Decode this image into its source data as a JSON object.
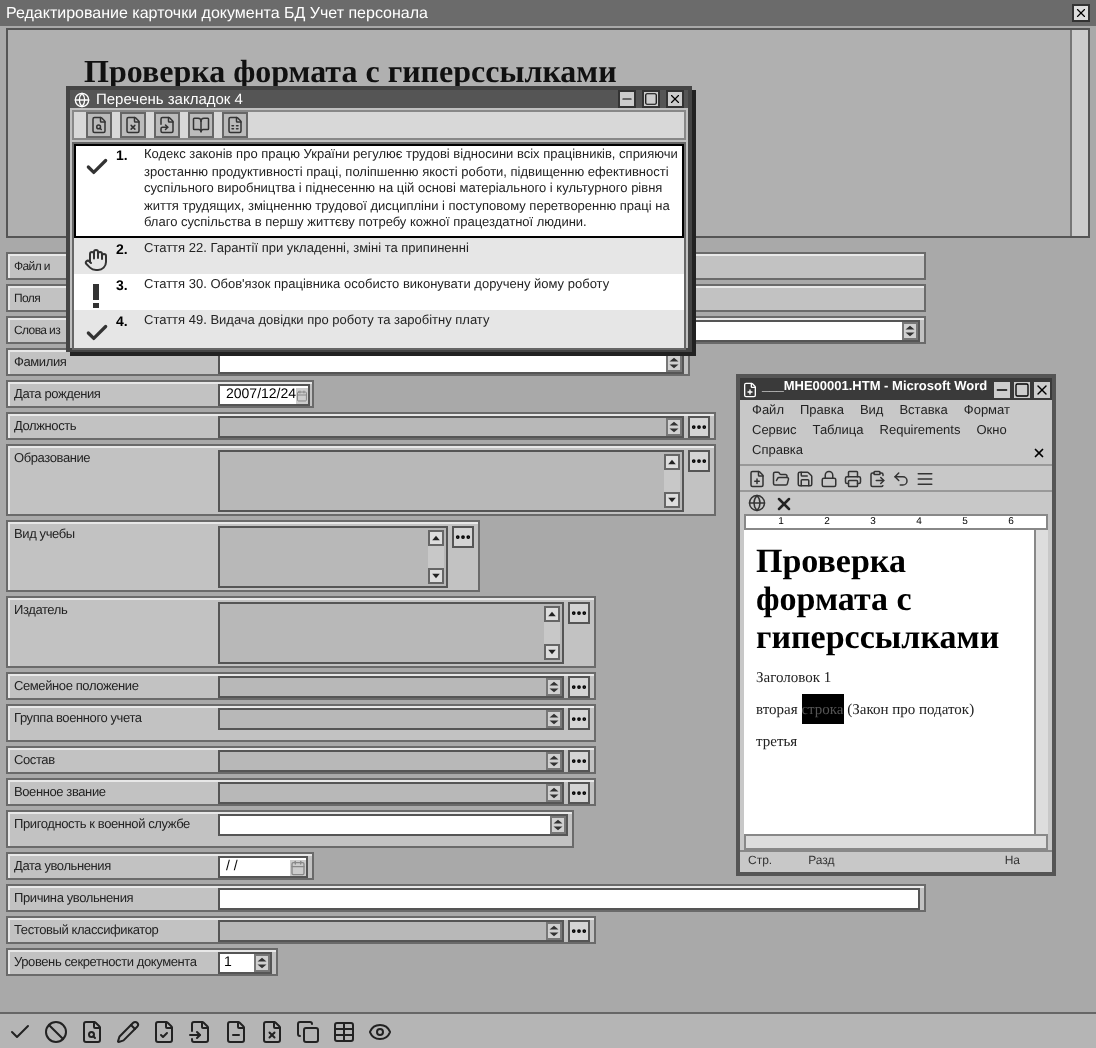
{
  "window": {
    "title": "Редактирование карточки документа БД Учет персонала"
  },
  "preview": {
    "heading": "Проверка формата с гиперссылками"
  },
  "fields": [
    {
      "label": "Файл и",
      "kind": "stub"
    },
    {
      "label": "Поля",
      "kind": "stub"
    },
    {
      "label": "Слова из",
      "kind": "text",
      "editable": true
    },
    {
      "label": "Фамилия",
      "kind": "text",
      "editable": true
    },
    {
      "label": "Дата рождения",
      "kind": "date",
      "value": "2007/12/24"
    },
    {
      "label": "Должность",
      "kind": "lookup",
      "editable": false
    },
    {
      "label": "Образование",
      "kind": "memo",
      "editable": false
    },
    {
      "label": "Вид учебы",
      "kind": "memo",
      "editable": false
    },
    {
      "label": "Издатель",
      "kind": "memo",
      "editable": false
    },
    {
      "label": "Семейное положение",
      "kind": "lookup",
      "editable": false
    },
    {
      "label": "Группа военного учета",
      "kind": "lookup",
      "editable": false
    },
    {
      "label": "Состав",
      "kind": "lookup",
      "editable": false
    },
    {
      "label": "Военное звание",
      "kind": "lookup",
      "editable": false
    },
    {
      "label": "Пригодность к военной службе",
      "kind": "text",
      "editable": true
    },
    {
      "label": "Дата увольнения",
      "kind": "date",
      "value": "/ /"
    },
    {
      "label": "Причина увольнения",
      "kind": "line",
      "editable": true
    },
    {
      "label": "Тестовый классификатор",
      "kind": "lookup",
      "editable": false
    },
    {
      "label": "Уровень секретности документа",
      "kind": "number",
      "value": "1"
    }
  ],
  "bookmarks": {
    "title": "Перечень закладок 4",
    "items": [
      {
        "kind": "check",
        "number": "1.",
        "text": "Кодекс законів про працю України регулює трудові відносини всіх працівників, сприяючи зростанню продуктивності праці, поліпшенню якості роботи, підвищенню ефективності суспільного виробництва і піднесенню на цій основі матеріального і культурного рівня життя трудящих, зміцненню трудової дисципліни і поступовому перетворенню праці на благо суспільства в першу життєву потребу кожної працездатної людини.",
        "selected": true
      },
      {
        "kind": "hand",
        "number": "2.",
        "text": "Стаття 22. Гарантії при укладенні, зміні та припиненні",
        "selected": false
      },
      {
        "kind": "exclamation",
        "number": "3.",
        "text": "Стаття 30. Обов'язок працівника особисто виконувати доручену йому роботу",
        "selected": false
      },
      {
        "kind": "check",
        "number": "4.",
        "text": "Стаття 49. Видача довідки про роботу та заробітну плату",
        "selected": false
      }
    ]
  },
  "word": {
    "title": "___MHE00001.HTM - Microsoft Word",
    "menu": [
      "Файл",
      "Правка",
      "Вид",
      "Вставка",
      "Формат",
      "Сервис",
      "Таблица",
      "Requirements",
      "Окно",
      "Справка"
    ],
    "ruler": [
      "1",
      "2",
      "3",
      "4",
      "5",
      "6"
    ],
    "heading": "Проверка формата с гиперссылками",
    "paragraphs": [
      [
        {
          "text": "Заголовок 1",
          "highlighted": false
        }
      ],
      [
        {
          "text": "вторая ",
          "highlighted": false
        },
        {
          "text": "строка",
          "highlighted": true
        },
        {
          "text": " (Закон про податок)",
          "highlighted": false
        }
      ],
      [
        {
          "text": "третья",
          "highlighted": false
        }
      ]
    ],
    "status_bar": [
      "Стр.",
      "Разд",
      "На"
    ]
  }
}
